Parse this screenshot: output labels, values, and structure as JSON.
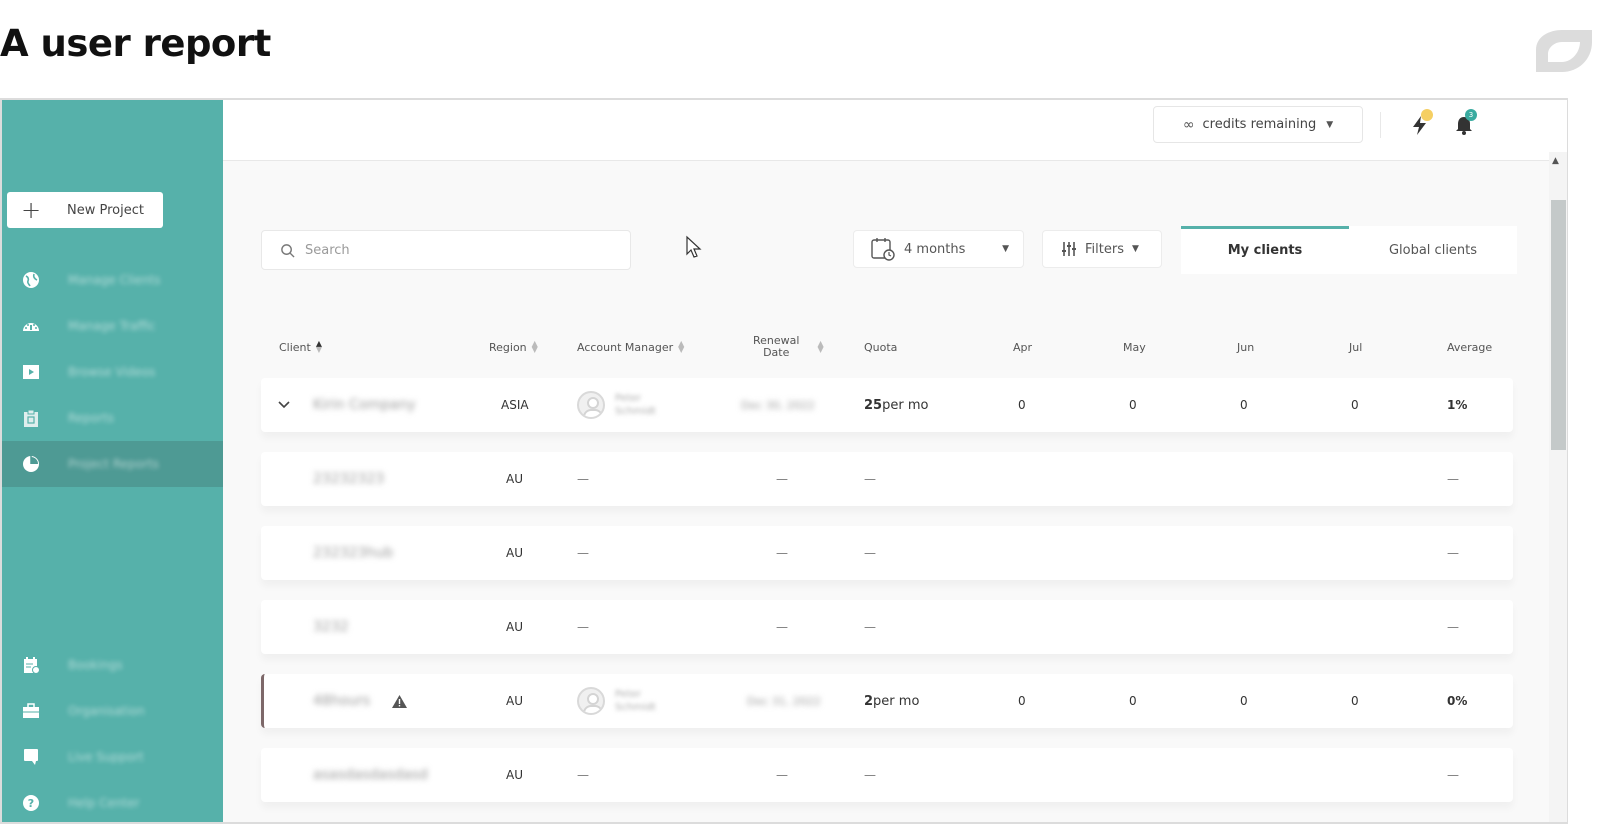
{
  "page_title": "A user report",
  "sidebar": {
    "new_project_label": "New Project",
    "items": [
      {
        "label": "Manage Clients",
        "icon": "globe-icon",
        "active": false
      },
      {
        "label": "Manage Traffic",
        "icon": "speedometer-icon",
        "active": false
      },
      {
        "label": "Browse Videos",
        "icon": "video-icon",
        "active": false
      },
      {
        "label": "Reports",
        "icon": "clipboard-icon",
        "active": false
      },
      {
        "label": "Project Reports",
        "icon": "pie-chart-icon",
        "active": true
      },
      {
        "label": "Bookings",
        "icon": "calendar-icon",
        "active": false
      },
      {
        "label": "Organisation",
        "icon": "briefcase-icon",
        "active": false
      },
      {
        "label": "Live Support",
        "icon": "chat-icon",
        "active": false
      },
      {
        "label": "Help Center",
        "icon": "help-icon",
        "active": false
      }
    ]
  },
  "topbar": {
    "credits_icon": "infinity-icon",
    "credits_label": "credits remaining",
    "notifications_badge": "3",
    "colors": {
      "lightning_dot": "#f5cf63",
      "bell_badge": "#3aaba0"
    }
  },
  "toolbar": {
    "search_placeholder": "Search",
    "period_label": "4 months",
    "filters_label": "Filters",
    "tabs": [
      {
        "label": "My clients",
        "active": true
      },
      {
        "label": "Global clients",
        "active": false
      }
    ]
  },
  "table": {
    "columns": {
      "client": "Client",
      "region": "Region",
      "account_manager": "Account Manager",
      "renewal_line1": "Renewal",
      "renewal_line2": "Date",
      "quota": "Quota",
      "apr": "Apr",
      "may": "May",
      "jun": "Jun",
      "jul": "Jul",
      "average": "Average"
    },
    "rows": [
      {
        "client": "Kirin Company",
        "region": "ASIA",
        "manager_first": "Peter",
        "manager_last": "Schmidt",
        "renewal": "Dec 30, 2022",
        "quota_num": "25",
        "quota_unit": " per mo",
        "apr": "0",
        "may": "0",
        "jun": "0",
        "jul": "0",
        "average": "1%",
        "expandable": true
      },
      {
        "client": "23232323",
        "region": "AU",
        "manager": "—",
        "renewal": "—",
        "quota": "—",
        "average": "—"
      },
      {
        "client": "232323hub",
        "region": "AU",
        "manager": "—",
        "renewal": "—",
        "quota": "—",
        "average": "—"
      },
      {
        "client": "3232",
        "region": "AU",
        "manager": "—",
        "renewal": "—",
        "quota": "—",
        "average": "—"
      },
      {
        "client": "48hours",
        "region": "AU",
        "manager_first": "Peter",
        "manager_last": "Schmidt",
        "renewal": "Dec 31, 2022",
        "quota_num": "2",
        "quota_unit": " per mo",
        "apr": "0",
        "may": "0",
        "jun": "0",
        "jul": "0",
        "average": "0%",
        "warning": true
      },
      {
        "client": "asasdasdasdasd",
        "region": "AU",
        "manager": "—",
        "renewal": "—",
        "quota": "—",
        "average": "—"
      }
    ]
  },
  "colors": {
    "sidebar": "#56b1aa",
    "sidebar_active": "#4e9a94",
    "accent": "#56b1aa",
    "flag_border": "#7d6869"
  }
}
